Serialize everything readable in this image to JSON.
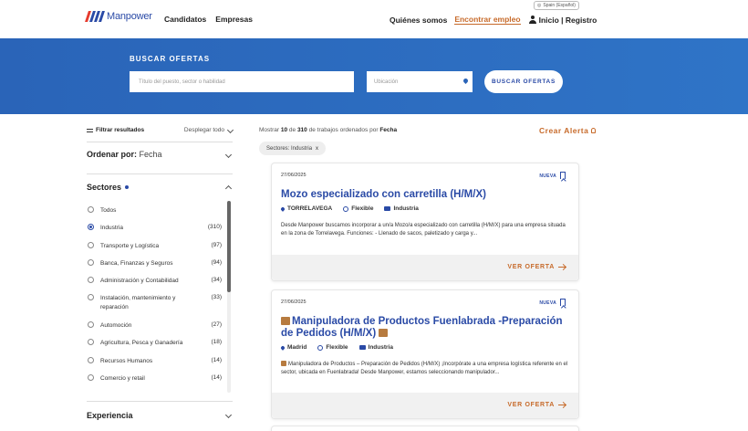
{
  "header": {
    "logo_text": "Manpower",
    "logo_colors": [
      "#e63b2e",
      "#2a4aa6",
      "#2a4aa6",
      "#2a4aa6"
    ],
    "nav_left": [
      "Candidatos",
      "Empresas"
    ],
    "nav_right": {
      "about": "Quiénes somos",
      "find_job": "Encontrar empleo",
      "login": "Inicio | Registro"
    },
    "language": "Spain (Español)"
  },
  "hero": {
    "title": "BUSCAR OFERTAS",
    "job_placeholder": "Título del puesto, sector o habilidad",
    "location_placeholder": "Ubicación",
    "button": "BUSCAR OFERTAS"
  },
  "sidebar": {
    "filter_label": "Filtrar resultados",
    "expand_label": "Desplegar todo",
    "sort_label": "Ordenar por:",
    "sort_value": "Fecha",
    "sectors_title": "Sectores",
    "sectors": [
      {
        "label": "Todos",
        "count": "",
        "checked": false
      },
      {
        "label": "Industria",
        "count": "(310)",
        "checked": true
      },
      {
        "label": "Transporte y Logística",
        "count": "(97)",
        "checked": false
      },
      {
        "label": "Banca, Finanzas y Seguros",
        "count": "(94)",
        "checked": false
      },
      {
        "label": "Administración y Contabilidad",
        "count": "(34)",
        "checked": false
      },
      {
        "label": "Instalación, mantenimiento y reparación",
        "count": "(33)",
        "checked": false
      },
      {
        "label": "Automoción",
        "count": "(27)",
        "checked": false
      },
      {
        "label": "Agricultura, Pesca y Ganadería",
        "count": "(18)",
        "checked": false
      },
      {
        "label": "Recursos Humanos",
        "count": "(14)",
        "checked": false
      },
      {
        "label": "Comercio y retail",
        "count": "(14)",
        "checked": false
      }
    ],
    "experience_title": "Experiencia"
  },
  "results": {
    "info_prefix": "Mostrar",
    "shown": "10",
    "info_of": "de",
    "total": "310",
    "info_suffix": "de trabajos ordenados por",
    "sorted_by": "Fecha",
    "alert_label": "Crear Alerta",
    "chip_label": "Sectores: Industria",
    "chip_close": "x",
    "jobs": [
      {
        "date": "27/06/2025",
        "badge": "NUEVA",
        "title": "Mozo especializado con carretilla (H/M/X)",
        "location": "TORRELAVEGA",
        "schedule": "Flexible",
        "sector": "Industria",
        "description": "Desde Manpower buscamos incorporar a un/a Mozo/a especializado con carretilla (H/M/X) para una empresa situada en la zona de Torrelavega. Funciones: - Llenado de sacos, paletizado y  carga y...",
        "cta": "VER OFERTA"
      },
      {
        "date": "27/06/2025",
        "badge": "NUEVA",
        "title": "Manipuladora de Productos Fuenlabrada -Preparación de Pedidos (H/M/X)",
        "location": "Madrid",
        "schedule": "Flexible",
        "sector": "Industria",
        "description": "Manipuladora de Productos – Preparación de Pedidos (H/M/X) ¡Incorpórate a una empresa logística referente en el sector, ubicada en Fuenlabrada! Desde Manpower, estamos seleccionando manipulador...",
        "cta": "VER OFERTA"
      }
    ]
  }
}
